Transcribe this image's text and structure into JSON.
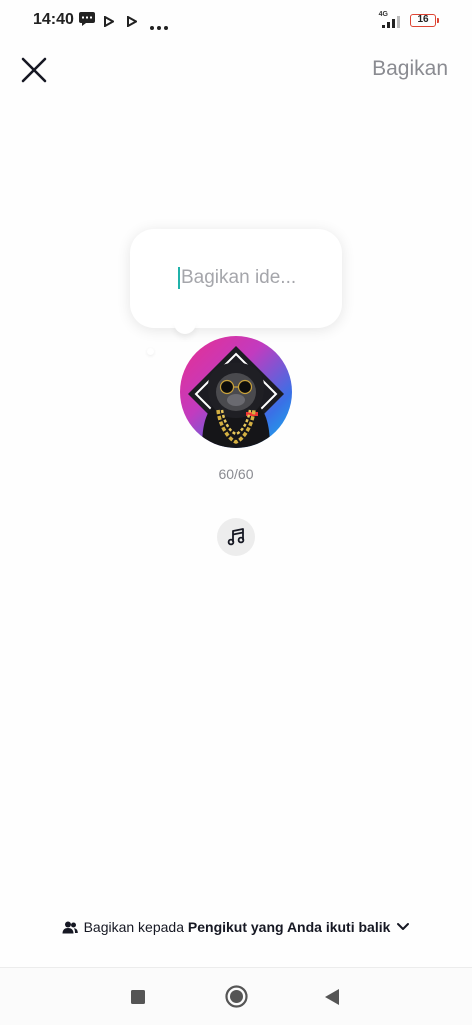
{
  "status_bar": {
    "time": "14:40",
    "network": "4G",
    "battery": "16",
    "battery_color": "#dd4433"
  },
  "header": {
    "close_icon": "close-icon",
    "share_label": "Bagikan"
  },
  "idea": {
    "placeholder": "Bagikan ide...",
    "char_counter": "60/60",
    "caret_color": "#20b2aa"
  },
  "music": {
    "icon": "music-note-icon"
  },
  "audience": {
    "prefix": "Bagikan kepada",
    "selection": "Pengikut yang Anda ikuti balik",
    "icon": "users-icon",
    "chevron": "chevron-down-icon"
  },
  "nav_bar": {
    "recent": "square-icon",
    "home": "circle-icon",
    "back": "triangle-back-icon"
  }
}
